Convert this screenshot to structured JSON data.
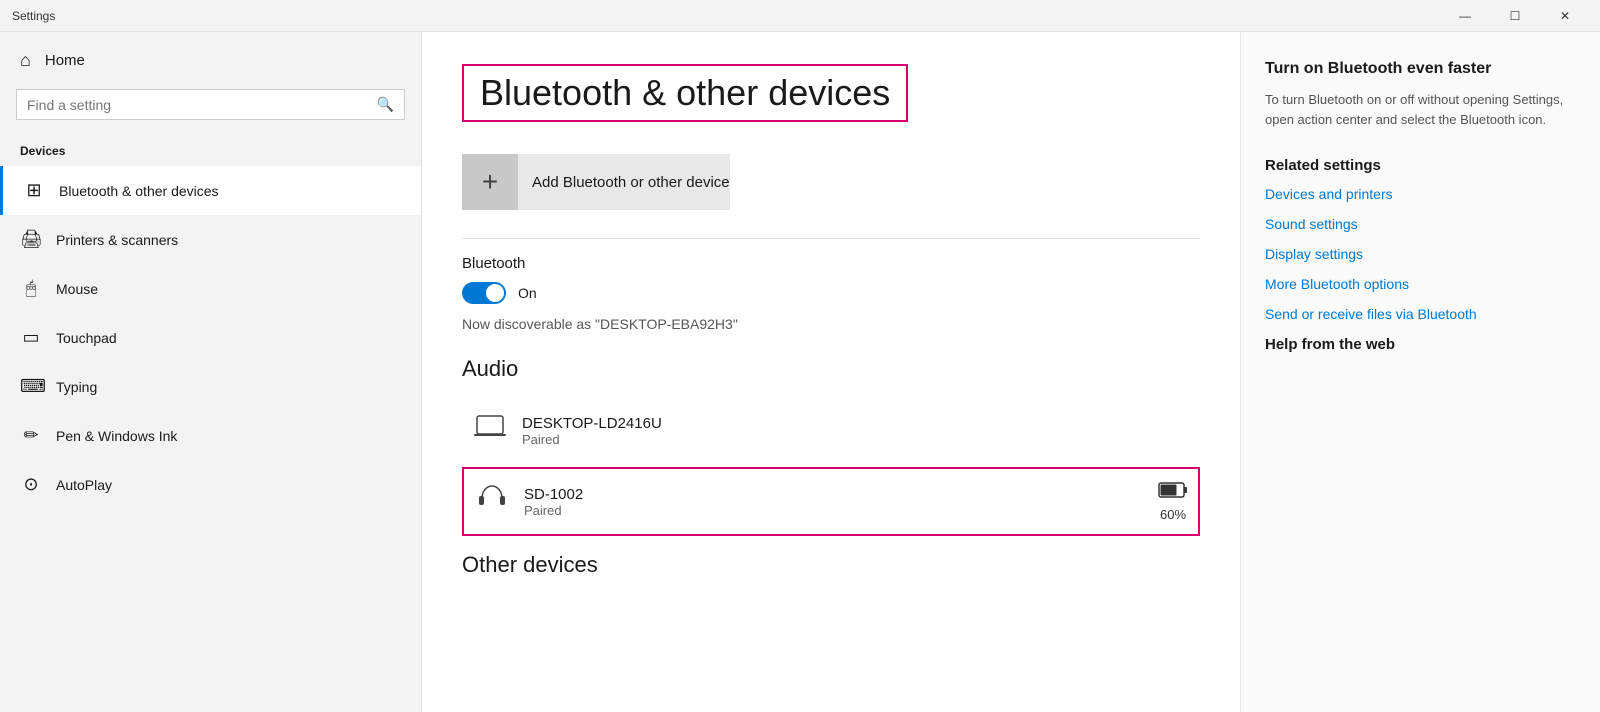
{
  "titlebar": {
    "title": "Settings",
    "minimize": "—",
    "maximize": "☐",
    "close": "✕"
  },
  "sidebar": {
    "home_label": "Home",
    "search_placeholder": "Find a setting",
    "section_label": "Devices",
    "items": [
      {
        "id": "bluetooth",
        "label": "Bluetooth & other devices",
        "icon": "🖥",
        "active": true
      },
      {
        "id": "printers",
        "label": "Printers & scanners",
        "icon": "🖨",
        "active": false
      },
      {
        "id": "mouse",
        "label": "Mouse",
        "icon": "🖱",
        "active": false
      },
      {
        "id": "touchpad",
        "label": "Touchpad",
        "icon": "⬜",
        "active": false
      },
      {
        "id": "typing",
        "label": "Typing",
        "icon": "⌨",
        "active": false
      },
      {
        "id": "pen",
        "label": "Pen & Windows Ink",
        "icon": "✏",
        "active": false
      },
      {
        "id": "autoplay",
        "label": "AutoPlay",
        "icon": "▶",
        "active": false
      }
    ]
  },
  "content": {
    "page_title": "Bluetooth & other devices",
    "add_device_label": "Add Bluetooth or other device",
    "bluetooth_label": "Bluetooth",
    "toggle_state": "On",
    "discoverable_text": "Now discoverable as \"DESKTOP-EBA92H3\"",
    "audio_title": "Audio",
    "devices": [
      {
        "id": "desktop-ld",
        "name": "DESKTOP-LD2416U",
        "status": "Paired",
        "icon": "💻",
        "selected": false,
        "battery": null
      },
      {
        "id": "sd1002",
        "name": "SD-1002",
        "status": "Paired",
        "icon": "🎧",
        "selected": true,
        "battery": "60%"
      }
    ],
    "other_devices_title": "Other devices"
  },
  "right_panel": {
    "tip_title": "Turn on Bluetooth even faster",
    "tip_text": "To turn Bluetooth on or off without opening Settings, open action center and select the Bluetooth icon.",
    "related_title": "Related settings",
    "related_links": [
      {
        "id": "devices-printers",
        "label": "Devices and printers"
      },
      {
        "id": "sound-settings",
        "label": "Sound settings"
      },
      {
        "id": "display-settings",
        "label": "Display settings"
      },
      {
        "id": "more-bluetooth",
        "label": "More Bluetooth options"
      },
      {
        "id": "send-receive",
        "label": "Send or receive files via Bluetooth"
      }
    ],
    "help_title": "Help from the web"
  }
}
